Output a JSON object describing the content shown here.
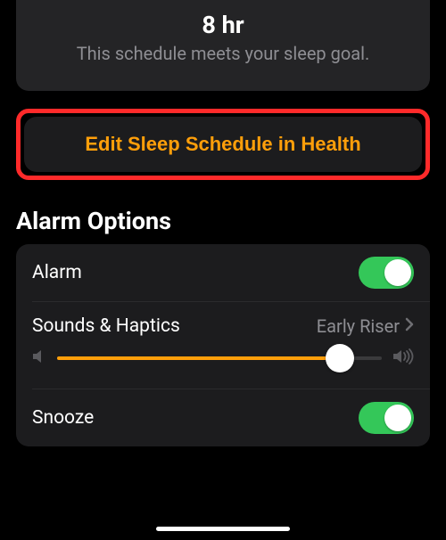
{
  "sleepSummary": {
    "duration": "8 hr",
    "status": "This schedule meets your sleep goal."
  },
  "editButton": {
    "label": "Edit Sleep Schedule in Health"
  },
  "alarmOptions": {
    "title": "Alarm Options",
    "alarm": {
      "label": "Alarm",
      "enabled": true
    },
    "sounds": {
      "label": "Sounds & Haptics",
      "value": "Early Riser",
      "volume_percent": 87
    },
    "snooze": {
      "label": "Snooze",
      "enabled": true
    }
  },
  "colors": {
    "accent": "#ff9f0a",
    "toggle_on": "#34c759"
  }
}
